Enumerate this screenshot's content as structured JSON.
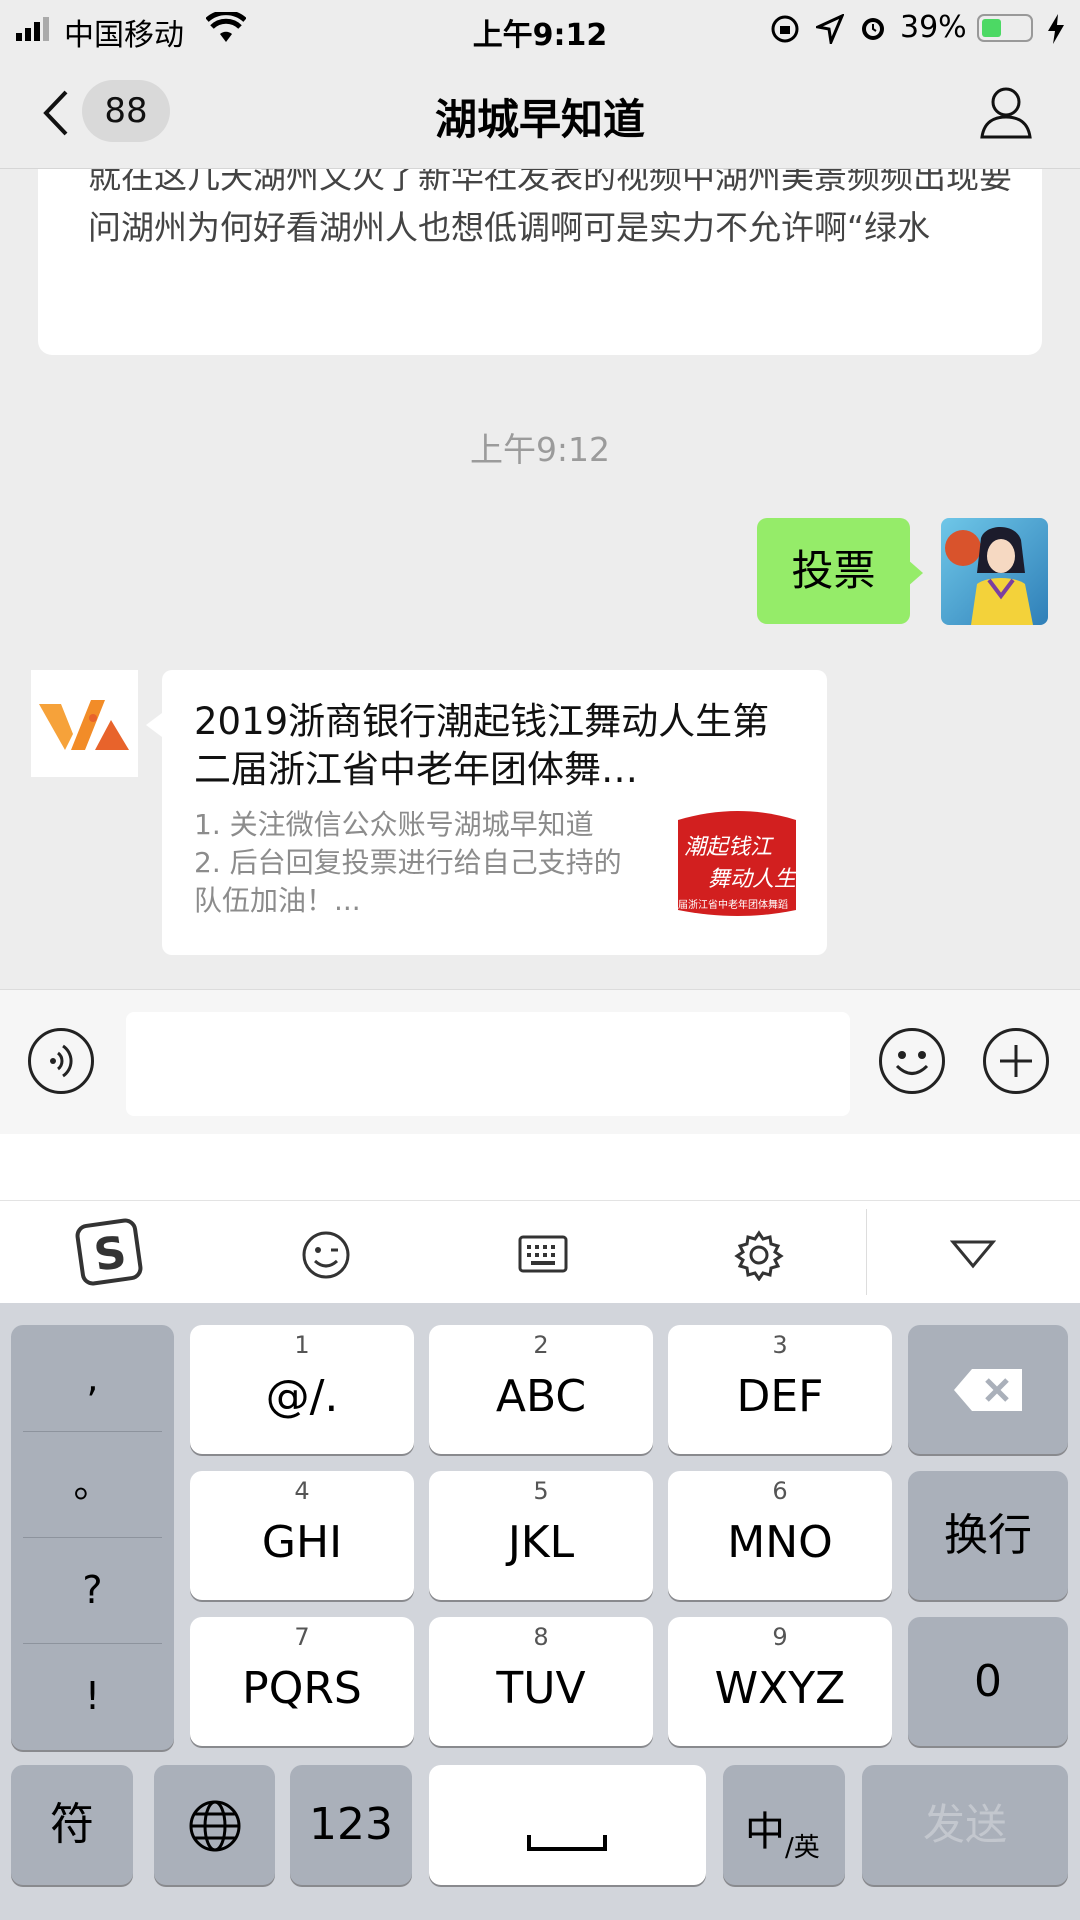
{
  "status": {
    "carrier": "中国移动",
    "time": "上午9:12",
    "battery": "39%"
  },
  "nav": {
    "back_count": "88",
    "title": "湖城早知道"
  },
  "chat": {
    "previous_text": "就在这几天湖州又火了新华社发表的视频中湖州美景频频出现要问湖州为何好看湖州人也想低调啊可是实力不允许啊“绿水",
    "time_label": "上午9:12",
    "my_message": "投票",
    "card": {
      "title": "2019浙商银行潮起钱江舞动人生第二届浙江省中老年团体舞…",
      "desc_line1": "1. 关注微信公众账号湖城早知道",
      "desc_line2": "2. 后台回复投票进行给自己支持的队伍加油！...",
      "thumb_text1": "潮起钱江",
      "thumb_text2": "舞动人生",
      "thumb_text3": "届浙江省中老年团体舞蹈"
    }
  },
  "input": {
    "placeholder": ""
  },
  "keyboard": {
    "punct": [
      ",",
      "。",
      "?",
      "!"
    ],
    "keys": [
      {
        "num": "1",
        "label": "@/."
      },
      {
        "num": "2",
        "label": "ABC"
      },
      {
        "num": "3",
        "label": "DEF"
      },
      {
        "num": "4",
        "label": "GHI"
      },
      {
        "num": "5",
        "label": "JKL"
      },
      {
        "num": "6",
        "label": "MNO"
      },
      {
        "num": "7",
        "label": "PQRS"
      },
      {
        "num": "8",
        "label": "TUV"
      },
      {
        "num": "9",
        "label": "WXYZ"
      }
    ],
    "newline": "换行",
    "zero": "0",
    "symbols": "符",
    "numeric": "123",
    "lang_main": "中",
    "lang_sub": "/英",
    "send": "发送"
  },
  "colors": {
    "my_bubble": "#95ec69",
    "keyboard_bg": "#d2d5db",
    "battery_fill": "#4cd964"
  }
}
